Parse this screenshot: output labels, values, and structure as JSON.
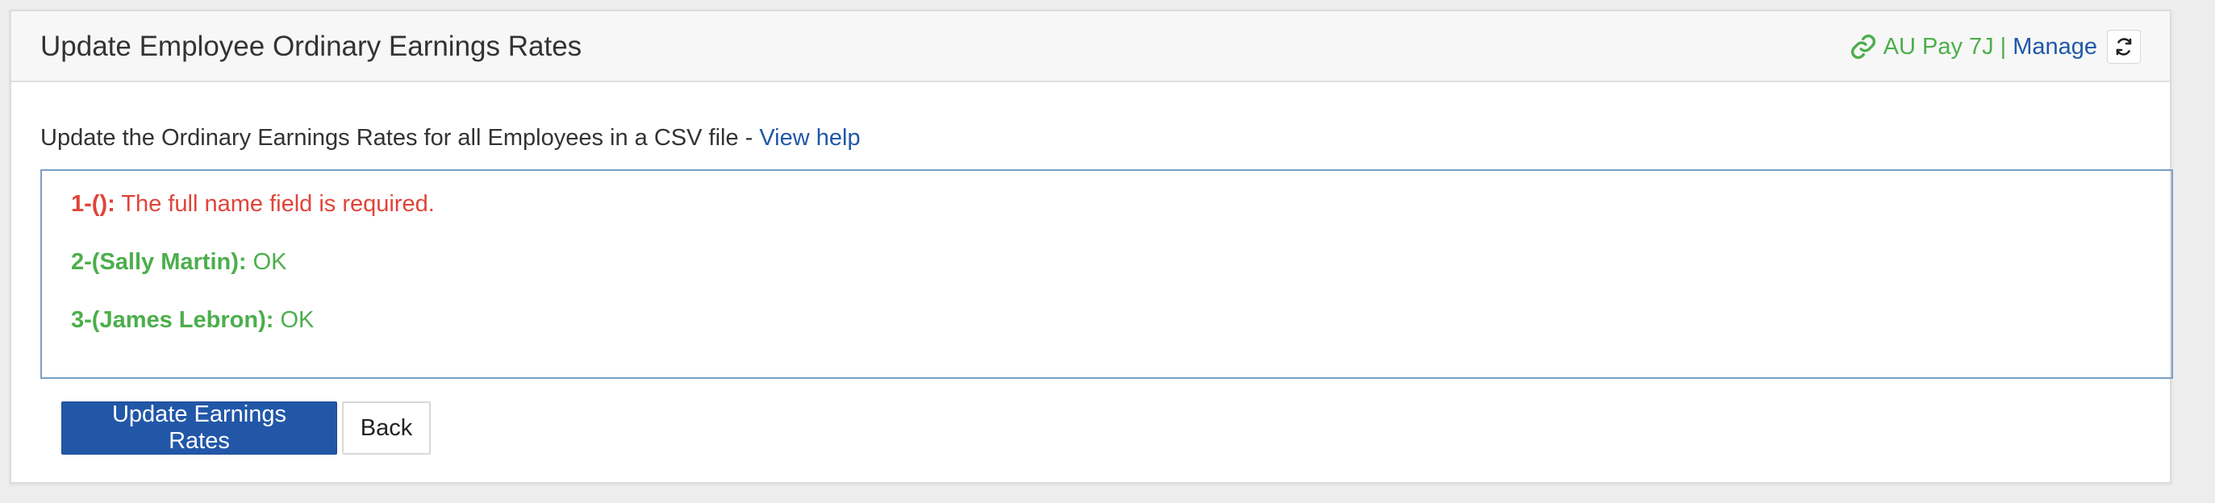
{
  "header": {
    "title": "Update Employee Ordinary Earnings Rates",
    "connection_name": "AU Pay 7J",
    "separator": "|",
    "manage_label": "Manage",
    "link_icon": "link-icon",
    "refresh_icon": "refresh-icon"
  },
  "intro": {
    "text": "Update the Ordinary Earnings Rates for all Employees in a CSV file - ",
    "help_label": "View help"
  },
  "results": [
    {
      "key": "1-():",
      "message": "The full name field is required.",
      "status": "error"
    },
    {
      "key": "2-(Sally Martin):",
      "message": "OK",
      "status": "ok"
    },
    {
      "key": "3-(James Lebron):",
      "message": "OK",
      "status": "ok"
    }
  ],
  "actions": {
    "update_label": "Update Earnings Rates",
    "back_label": "Back"
  },
  "colors": {
    "error": "#e0443a",
    "ok": "#4cae4c",
    "link": "#2058a8",
    "primary_button": "#2257a8"
  }
}
